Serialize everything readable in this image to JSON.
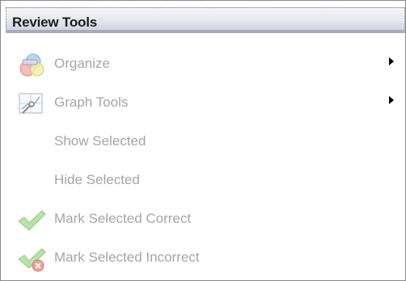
{
  "panel": {
    "title": "Review Tools"
  },
  "menu": {
    "items": [
      {
        "label": "Organize",
        "icon": "organize-icon",
        "has_submenu": true
      },
      {
        "label": "Graph Tools",
        "icon": "graph-tools-icon",
        "has_submenu": true
      },
      {
        "label": "Show Selected",
        "icon": null,
        "has_submenu": false
      },
      {
        "label": "Hide Selected",
        "icon": null,
        "has_submenu": false
      },
      {
        "label": "Mark Selected Correct",
        "icon": "checkmark-icon",
        "has_submenu": false
      },
      {
        "label": "Mark Selected Incorrect",
        "icon": "checkmark-with-x-icon",
        "has_submenu": false
      }
    ]
  },
  "colors": {
    "disabled_text": "#a6a6a6",
    "header_border": "#a8aac0"
  }
}
